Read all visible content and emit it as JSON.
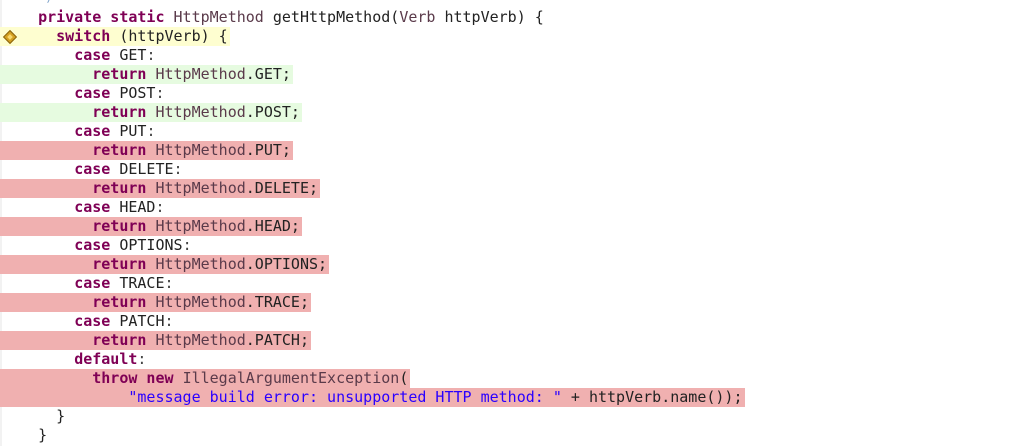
{
  "code": {
    "top_fragment": "*/",
    "lines": [
      {
        "indent": 2,
        "highlight": "none",
        "tokens": [
          {
            "t": "private static ",
            "c": "kw"
          },
          {
            "t": "HttpMethod",
            "c": "type"
          },
          {
            "t": " getHttpMethod(",
            "c": "plain"
          },
          {
            "t": "Verb",
            "c": "type"
          },
          {
            "t": " httpVerb) {",
            "c": "plain"
          }
        ]
      },
      {
        "indent": 4,
        "highlight": "yellow",
        "marker": "diamond",
        "tokens": [
          {
            "t": "switch ",
            "c": "kw"
          },
          {
            "t": "(httpVerb) {",
            "c": "plain"
          }
        ]
      },
      {
        "indent": 6,
        "highlight": "none",
        "tokens": [
          {
            "t": "case ",
            "c": "kw"
          },
          {
            "t": "GET",
            "c": "plain"
          },
          {
            "t": ":",
            "c": "op"
          }
        ]
      },
      {
        "indent": 8,
        "highlight": "green",
        "tokens": [
          {
            "t": "return ",
            "c": "kw"
          },
          {
            "t": "HttpMethod",
            "c": "type"
          },
          {
            "t": ".GET;",
            "c": "plain"
          }
        ]
      },
      {
        "indent": 6,
        "highlight": "none",
        "tokens": [
          {
            "t": "case ",
            "c": "kw"
          },
          {
            "t": "POST",
            "c": "plain"
          },
          {
            "t": ":",
            "c": "op"
          }
        ]
      },
      {
        "indent": 8,
        "highlight": "green",
        "tokens": [
          {
            "t": "return ",
            "c": "kw"
          },
          {
            "t": "HttpMethod",
            "c": "type"
          },
          {
            "t": ".POST;",
            "c": "plain"
          }
        ]
      },
      {
        "indent": 6,
        "highlight": "none",
        "tokens": [
          {
            "t": "case ",
            "c": "kw"
          },
          {
            "t": "PUT",
            "c": "plain"
          },
          {
            "t": ":",
            "c": "op"
          }
        ]
      },
      {
        "indent": 8,
        "highlight": "red",
        "tokens": [
          {
            "t": "return ",
            "c": "kw"
          },
          {
            "t": "HttpMethod",
            "c": "type"
          },
          {
            "t": ".PUT;",
            "c": "plain"
          }
        ]
      },
      {
        "indent": 6,
        "highlight": "none",
        "tokens": [
          {
            "t": "case ",
            "c": "kw"
          },
          {
            "t": "DELETE",
            "c": "plain"
          },
          {
            "t": ":",
            "c": "op"
          }
        ]
      },
      {
        "indent": 8,
        "highlight": "red",
        "tokens": [
          {
            "t": "return ",
            "c": "kw"
          },
          {
            "t": "HttpMethod",
            "c": "type"
          },
          {
            "t": ".DELETE;",
            "c": "plain"
          }
        ]
      },
      {
        "indent": 6,
        "highlight": "none",
        "tokens": [
          {
            "t": "case ",
            "c": "kw"
          },
          {
            "t": "HEAD",
            "c": "plain"
          },
          {
            "t": ":",
            "c": "op"
          }
        ]
      },
      {
        "indent": 8,
        "highlight": "red",
        "tokens": [
          {
            "t": "return ",
            "c": "kw"
          },
          {
            "t": "HttpMethod",
            "c": "type"
          },
          {
            "t": ".HEAD;",
            "c": "plain"
          }
        ]
      },
      {
        "indent": 6,
        "highlight": "none",
        "tokens": [
          {
            "t": "case ",
            "c": "kw"
          },
          {
            "t": "OPTIONS",
            "c": "plain"
          },
          {
            "t": ":",
            "c": "op"
          }
        ]
      },
      {
        "indent": 8,
        "highlight": "red",
        "tokens": [
          {
            "t": "return ",
            "c": "kw"
          },
          {
            "t": "HttpMethod",
            "c": "type"
          },
          {
            "t": ".OPTIONS;",
            "c": "plain"
          }
        ]
      },
      {
        "indent": 6,
        "highlight": "none",
        "tokens": [
          {
            "t": "case ",
            "c": "kw"
          },
          {
            "t": "TRACE",
            "c": "plain"
          },
          {
            "t": ":",
            "c": "op"
          }
        ]
      },
      {
        "indent": 8,
        "highlight": "red",
        "tokens": [
          {
            "t": "return ",
            "c": "kw"
          },
          {
            "t": "HttpMethod",
            "c": "type"
          },
          {
            "t": ".TRACE;",
            "c": "plain"
          }
        ]
      },
      {
        "indent": 6,
        "highlight": "none",
        "tokens": [
          {
            "t": "case ",
            "c": "kw"
          },
          {
            "t": "PATCH",
            "c": "plain"
          },
          {
            "t": ":",
            "c": "op"
          }
        ]
      },
      {
        "indent": 8,
        "highlight": "red",
        "tokens": [
          {
            "t": "return ",
            "c": "kw"
          },
          {
            "t": "HttpMethod",
            "c": "type"
          },
          {
            "t": ".PATCH;",
            "c": "plain"
          }
        ]
      },
      {
        "indent": 6,
        "highlight": "none",
        "tokens": [
          {
            "t": "default",
            "c": "kw"
          },
          {
            "t": ":",
            "c": "op"
          }
        ]
      },
      {
        "indent": 8,
        "highlight": "red",
        "tokens": [
          {
            "t": "throw new ",
            "c": "kw"
          },
          {
            "t": "IllegalArgumentException",
            "c": "type"
          },
          {
            "t": "(",
            "c": "plain"
          }
        ]
      },
      {
        "indent": 12,
        "highlight": "red",
        "tokens": [
          {
            "t": "\"message build error: unsupported HTTP method: \"",
            "c": "str"
          },
          {
            "t": " + httpVerb.name());",
            "c": "plain"
          }
        ]
      },
      {
        "indent": 4,
        "highlight": "none",
        "tokens": [
          {
            "t": "}",
            "c": "plain"
          }
        ]
      },
      {
        "indent": 2,
        "highlight": "none",
        "tokens": [
          {
            "t": "}",
            "c": "plain"
          }
        ]
      }
    ]
  },
  "colors": {
    "keyword": "#7f0055",
    "string": "#2a00ff",
    "covered_green": "#e6fbe0",
    "missed_red": "#f0b0b0",
    "current_yellow": "#fefed0"
  },
  "icons": {
    "breakpoint_marker": "diamond-marker-icon"
  }
}
